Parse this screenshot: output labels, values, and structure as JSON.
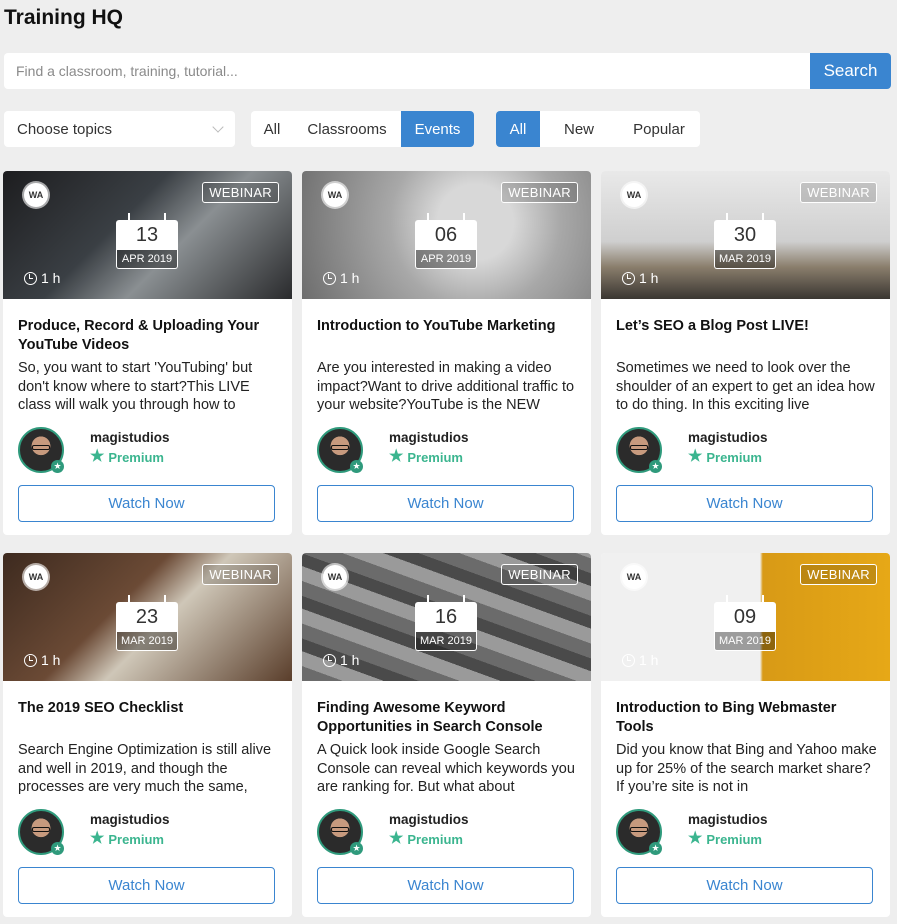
{
  "app": {
    "title": "Training HQ"
  },
  "search": {
    "placeholder": "Find a classroom, training, tutorial...",
    "button_label": "Search"
  },
  "filters": {
    "topics_label": "Choose topics",
    "type_options": [
      "All",
      "Classrooms",
      "Events"
    ],
    "type_selected": "Events",
    "sort_options": [
      "All",
      "New",
      "Popular"
    ],
    "sort_selected": "All"
  },
  "colors": {
    "accent": "#3a85d0",
    "premium": "#3bb58f",
    "avatar_ring": "#2f9a7c"
  },
  "cards": [
    {
      "badge": "WEBINAR",
      "logo": "WA",
      "day": "13",
      "month": "APR 2019",
      "duration": "1 h",
      "title": "Produce, Record & Uploading Your YouTube Videos",
      "description": "So, you want to start 'YouTubing' but don't know where to start?This LIVE class will walk you through how to",
      "author": "magistudios",
      "tier": "Premium",
      "button": "Watch Now",
      "thumb_icon": "laptop-studio-image"
    },
    {
      "badge": "WEBINAR",
      "logo": "WA",
      "day": "06",
      "month": "APR 2019",
      "duration": "1 h",
      "title": "Introduction to YouTube Marketing",
      "description": "Are you interested in making a video impact?Want to drive additional traffic to your website?YouTube is the NEW",
      "author": "magistudios",
      "tier": "Premium",
      "button": "Watch Now",
      "thumb_icon": "youtube-screen-image"
    },
    {
      "badge": "WEBINAR",
      "logo": "WA",
      "day": "30",
      "month": "MAR 2019",
      "duration": "1 h",
      "title": "Let’s SEO a Blog Post LIVE!",
      "description": "Sometimes we need to look over the shoulder of an expert to get an idea how to do thing. In this exciting live",
      "author": "magistudios",
      "tier": "Premium",
      "button": "Watch Now",
      "thumb_icon": "blog-typewriter-image"
    },
    {
      "badge": "WEBINAR",
      "logo": "WA",
      "day": "23",
      "month": "MAR 2019",
      "duration": "1 h",
      "title": "The 2019 SEO Checklist",
      "description": "Search Engine Optimization is still alive and well in 2019, and though the processes are very much the same,",
      "author": "magistudios",
      "tier": "Premium",
      "button": "Watch Now",
      "thumb_icon": "seo-tiles-image"
    },
    {
      "badge": "WEBINAR",
      "logo": "WA",
      "day": "16",
      "month": "MAR 2019",
      "duration": "1 h",
      "title": "Finding Awesome Keyword Opportunities in Search Console",
      "description": "A Quick look inside Google Search Console can reveal which keywords you are ranking for. But what about",
      "author": "magistudios",
      "tier": "Premium",
      "button": "Watch Now",
      "thumb_icon": "keyword-tiles-image"
    },
    {
      "badge": "WEBINAR",
      "logo": "WA",
      "day": "09",
      "month": "MAR 2019",
      "duration": "1 h",
      "title": "Introduction to Bing Webmaster Tools",
      "description": "Did you know that Bing and Yahoo make up for 25% of the search market share? If you’re site is not in",
      "author": "magistudios",
      "tier": "Premium",
      "button": "Watch Now",
      "thumb_icon": "bing-logo-image"
    }
  ]
}
